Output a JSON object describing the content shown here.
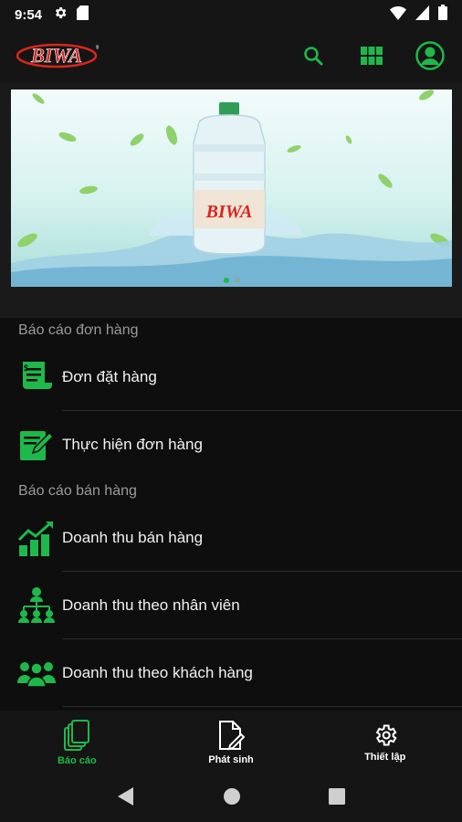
{
  "status_bar": {
    "time": "9:54",
    "left_icons": [
      "gear-icon",
      "sd-card-icon"
    ],
    "right_icons": [
      "wifi-icon",
      "signal-icon",
      "battery-icon"
    ]
  },
  "app_bar": {
    "logo_text": "BIWA",
    "actions": [
      "search-icon",
      "grid-icon",
      "account-icon"
    ]
  },
  "banner": {
    "bottle_label": "BIWA",
    "dot_count": 2
  },
  "sections": [
    {
      "header": "Báo cáo đơn hàng",
      "items": [
        {
          "label": "Đơn đặt hàng",
          "icon": "invoice-icon"
        },
        {
          "label": "Thực hiện đơn hàng",
          "icon": "edit-document-icon"
        }
      ]
    },
    {
      "header": "Báo cáo bán hàng",
      "items": [
        {
          "label": "Doanh thu bán hàng",
          "icon": "growth-chart-icon"
        },
        {
          "label": "Doanh thu theo nhân viên",
          "icon": "org-chart-icon"
        },
        {
          "label": "Doanh thu theo khách hàng",
          "icon": "customers-icon"
        }
      ]
    }
  ],
  "bottom_nav": [
    {
      "label": "Báo cáo",
      "icon": "reports-icon",
      "active": true
    },
    {
      "label": "Phát sinh",
      "icon": "document-edit-icon",
      "active": false
    },
    {
      "label": "Thiết lập",
      "icon": "settings-icon",
      "active": false
    }
  ],
  "system_nav": [
    "back-icon",
    "home-icon",
    "recents-icon"
  ],
  "colors": {
    "accent": "#1fb84a",
    "background": "#0e0e0e",
    "bar": "#151515",
    "text": "#f1f1f1",
    "muted": "#9a9a9a",
    "logo_red": "#d7261e"
  }
}
